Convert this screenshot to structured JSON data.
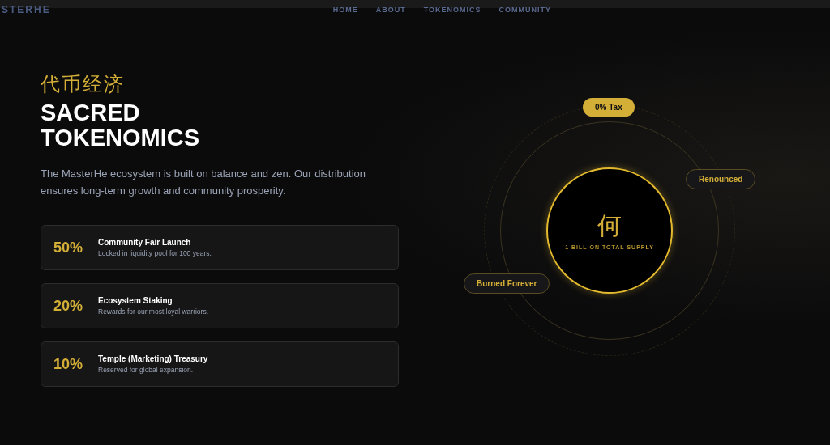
{
  "nav": {
    "logo": "STERHE",
    "links": [
      {
        "label": "HOME"
      },
      {
        "label": "ABOUT"
      },
      {
        "label": "TOKENOMICS"
      },
      {
        "label": "COMMUNITY"
      }
    ]
  },
  "section": {
    "kicker": "代币经济",
    "title_lines": [
      "SACRED",
      "TOKENOMICS"
    ],
    "description": "The MasterHe ecosystem is built on balance and zen. Our distribution ensures long-term growth and community prosperity."
  },
  "allocations": [
    {
      "percent": "50%",
      "title": "Community Fair Launch",
      "subtitle": "Locked in liquidity pool for 100 years."
    },
    {
      "percent": "20%",
      "title": "Ecosystem Staking",
      "subtitle": "Rewards for our most loyal warriors."
    },
    {
      "percent": "10%",
      "title": "Temple (Marketing) Treasury",
      "subtitle": "Reserved for global expansion."
    }
  ],
  "diagram": {
    "glyph": "何",
    "caption": "1 BILLION TOTAL SUPPLY",
    "badges": [
      {
        "label": "0% Tax",
        "kind": "filled"
      },
      {
        "label": "Renounced",
        "kind": "outline"
      },
      {
        "label": "Burned Forever",
        "kind": "outline"
      }
    ]
  }
}
